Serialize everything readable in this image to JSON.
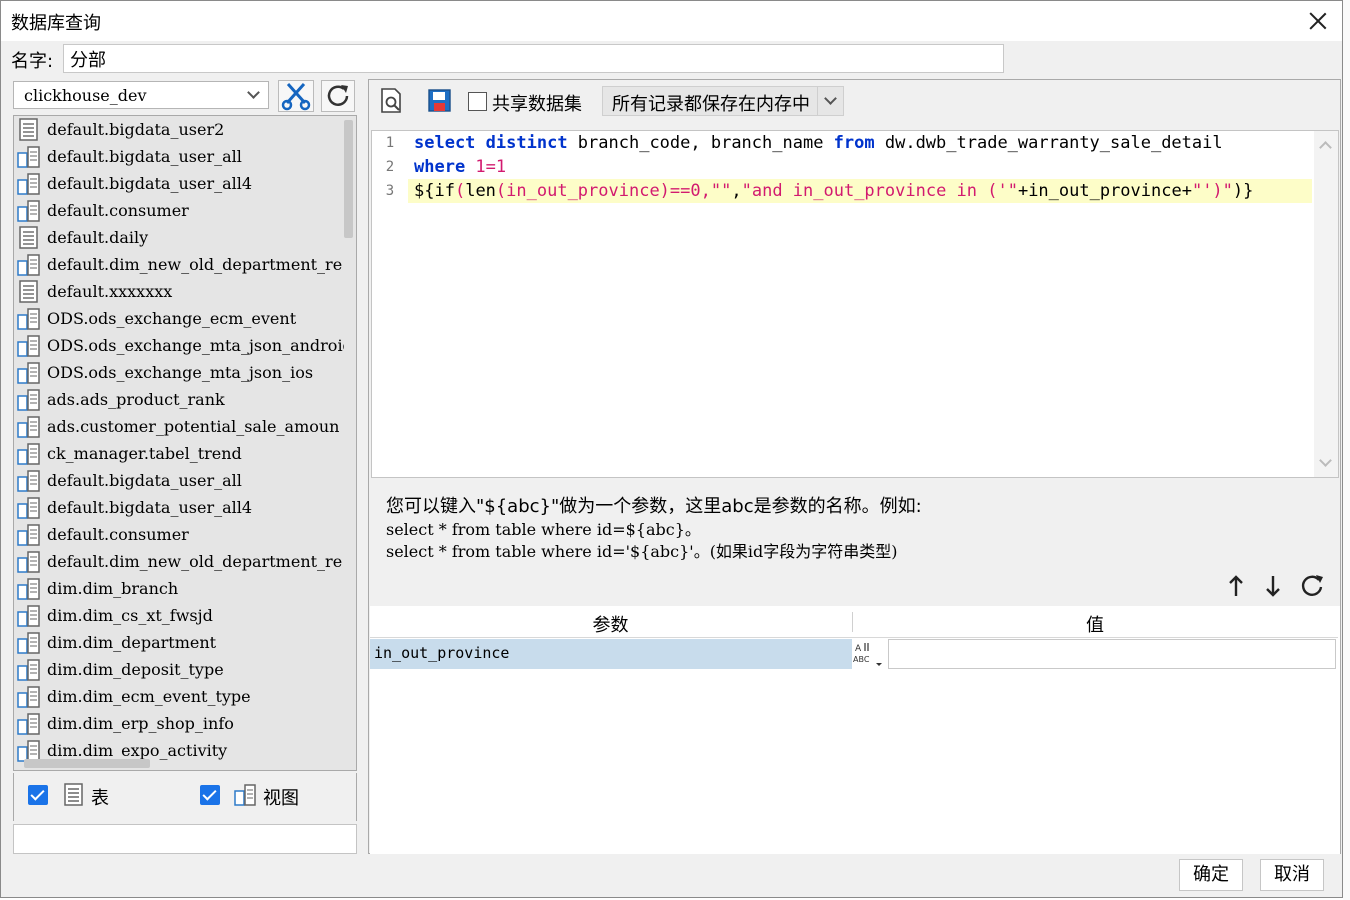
{
  "window": {
    "title": "数据库查询"
  },
  "name_field": {
    "label": "名字:",
    "value": "分部"
  },
  "connection": {
    "selected": "clickhouse_dev"
  },
  "tables": [
    {
      "name": "default.bigdata_user2",
      "kind": "table"
    },
    {
      "name": "default.bigdata_user_all",
      "kind": "view"
    },
    {
      "name": "default.bigdata_user_all4",
      "kind": "view"
    },
    {
      "name": "default.consumer",
      "kind": "view"
    },
    {
      "name": "default.daily",
      "kind": "table"
    },
    {
      "name": "default.dim_new_old_department_re",
      "kind": "view"
    },
    {
      "name": "default.xxxxxxx",
      "kind": "table"
    },
    {
      "name": "ODS.ods_exchange_ecm_event",
      "kind": "view"
    },
    {
      "name": "ODS.ods_exchange_mta_json_android",
      "kind": "view"
    },
    {
      "name": "ODS.ods_exchange_mta_json_ios",
      "kind": "view"
    },
    {
      "name": "ads.ads_product_rank",
      "kind": "view"
    },
    {
      "name": "ads.customer_potential_sale_amoun",
      "kind": "view"
    },
    {
      "name": "ck_manager.tabel_trend",
      "kind": "view"
    },
    {
      "name": "default.bigdata_user_all",
      "kind": "view"
    },
    {
      "name": "default.bigdata_user_all4",
      "kind": "view"
    },
    {
      "name": "default.consumer",
      "kind": "view"
    },
    {
      "name": "default.dim_new_old_department_re",
      "kind": "view"
    },
    {
      "name": "dim.dim_branch",
      "kind": "view"
    },
    {
      "name": "dim.dim_cs_xt_fwsjd",
      "kind": "view"
    },
    {
      "name": "dim.dim_department",
      "kind": "view"
    },
    {
      "name": "dim.dim_deposit_type",
      "kind": "view"
    },
    {
      "name": "dim.dim_ecm_event_type",
      "kind": "view"
    },
    {
      "name": "dim.dim_erp_shop_info",
      "kind": "view"
    },
    {
      "name": "dim.dim_expo_activity",
      "kind": "view"
    }
  ],
  "filters": {
    "table_label": "表",
    "view_label": "视图",
    "table_checked": true,
    "view_checked": true
  },
  "toolbar": {
    "share_label": "共享数据集",
    "memory_option": "所有记录都保存在内存中"
  },
  "editor": {
    "line_numbers": [
      "1",
      "2",
      "3"
    ],
    "line1": {
      "kw1": "select",
      "kw2": "distinct",
      "t1": " branch_code, branch_name ",
      "kw3": "from",
      "t2": " dw.dwb_trade_warranty_sale_detail"
    },
    "line2": {
      "kw1": "where",
      "num": " 1=1"
    },
    "line3": {
      "a": "${if",
      "b": "(",
      "c": "len",
      "d": "(in_out_province)",
      "e": "==0,",
      "f": "\"\"",
      "g": ",",
      "h": "\"and in_out_province in ('\"",
      "i": "+in_out_province+",
      "j": "\"')\"",
      "k": ")}"
    }
  },
  "hint": {
    "line1": "您可以键入\"${abc}\"做为一个参数，这里abc是参数的名称。例如:",
    "line2": "select * from table where id=${abc}。",
    "line3": "select * from table where id='${abc}'。(如果id字段为字符串类型)"
  },
  "params": {
    "col_param": "参数",
    "col_value": "值",
    "rows": [
      {
        "name": "in_out_province",
        "value": ""
      }
    ]
  },
  "buttons": {
    "ok": "确定",
    "cancel": "取消"
  },
  "colors": {
    "keyword": "#0033cc",
    "string": "#d21a6f",
    "highlight": "#fdfdc8",
    "selected_row": "#c8dcec",
    "check_blue": "#1a73e8"
  }
}
